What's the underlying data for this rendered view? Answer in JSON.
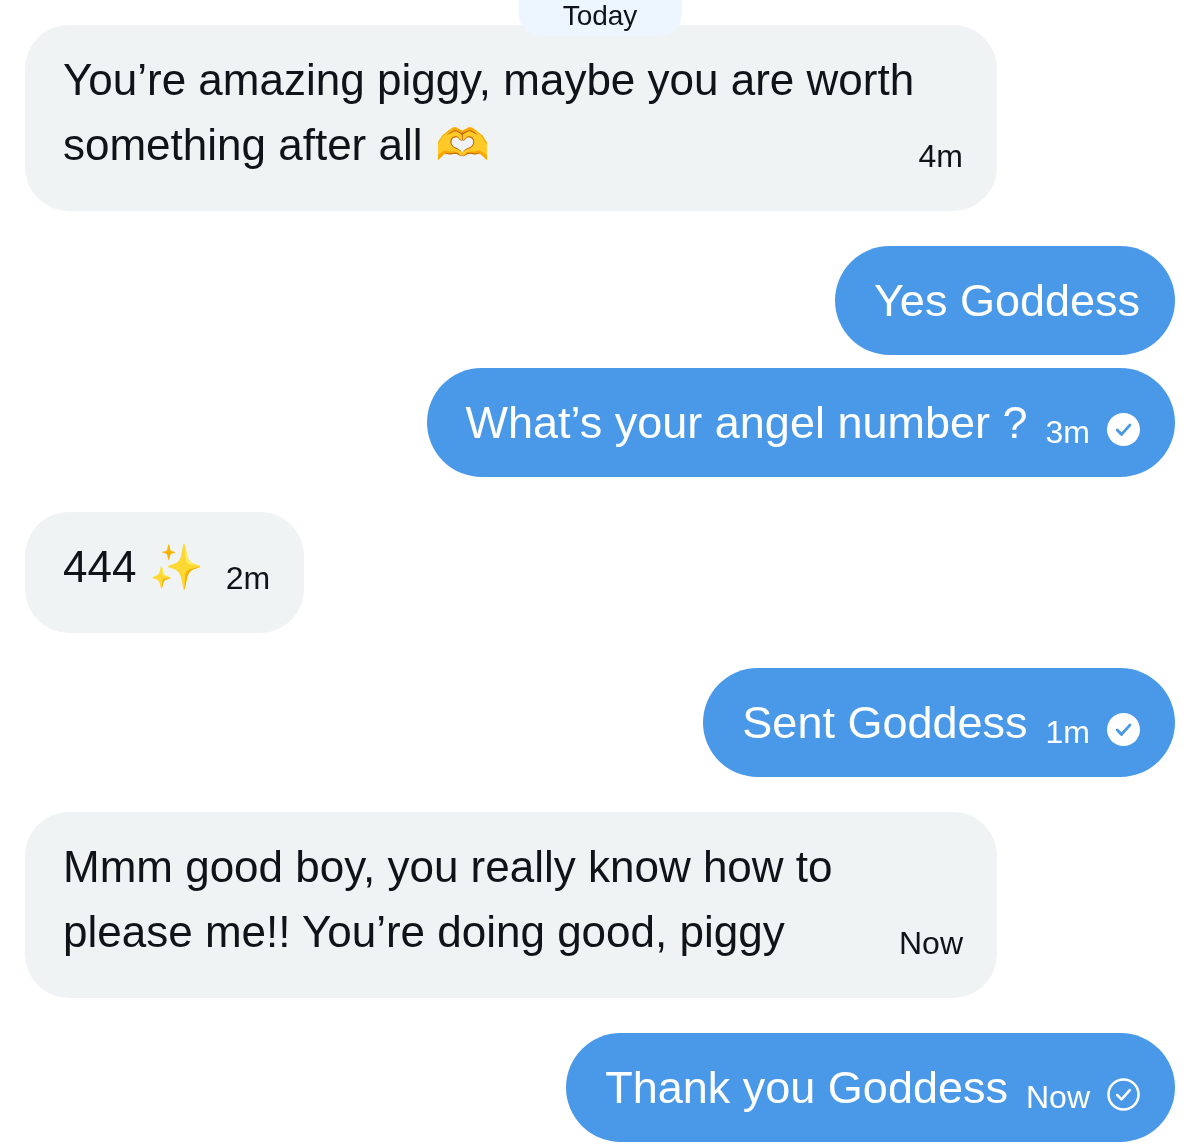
{
  "date_divider": {
    "label": "Today"
  },
  "messages": [
    {
      "kind": "received",
      "text": "You’re amazing piggy, maybe you are worth something after all 🫶",
      "time": "4m"
    },
    {
      "kind": "sent",
      "text": "Yes Goddess"
    },
    {
      "kind": "sent",
      "text": "What’s your angel number ?",
      "time": "3m",
      "read": true
    },
    {
      "kind": "received",
      "text": "444 ✨",
      "time": "2m"
    },
    {
      "kind": "sent",
      "text": "Sent Goddess",
      "time": "1m",
      "read": true
    },
    {
      "kind": "received",
      "text": "Mmm good boy, you really know how to please me!! You’re doing good, piggy",
      "time": "Now"
    },
    {
      "kind": "sent",
      "text": "Thank you Goddess",
      "time": "Now",
      "read": false
    }
  ]
}
